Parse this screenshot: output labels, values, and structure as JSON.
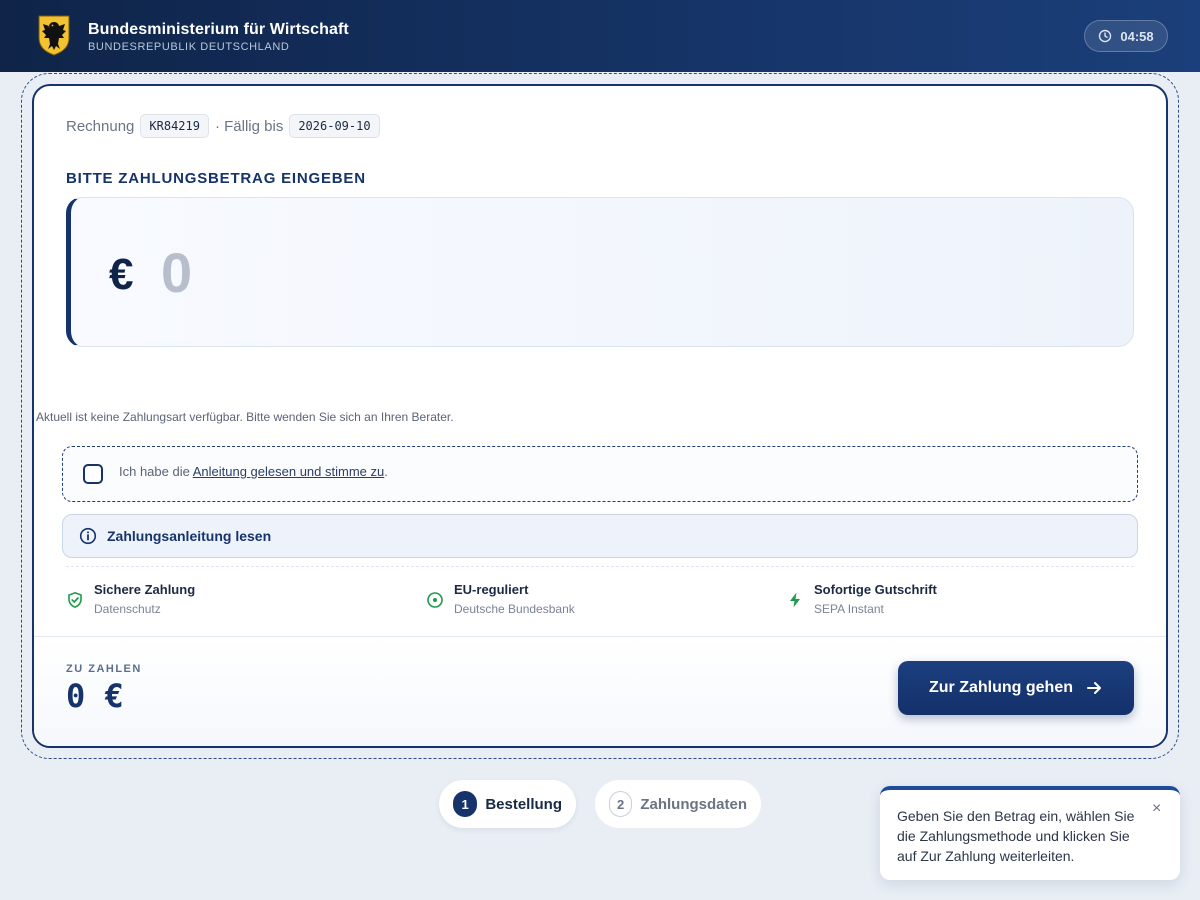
{
  "header": {
    "title": "Bundesministerium für Wirtschaft",
    "subtitle": "BUNDESREPUBLIK DEUTSCHLAND",
    "timer": "04:58"
  },
  "invoice": {
    "label": "Rechnung",
    "number": "KR84219",
    "due_label": "· Fällig bis",
    "due_date": "2026-09-10"
  },
  "amount": {
    "section_title": "BITTE ZAHLUNGSBETRAG EINGEBEN",
    "currency": "€",
    "placeholder": "0",
    "value": ""
  },
  "notice": "Aktuell ist keine Zahlungsart verfügbar. Bitte wenden Sie sich an Ihren Berater.",
  "agreement": {
    "prefix": "Ich habe die ",
    "link": "Anleitung gelesen und stimme zu",
    "suffix": ".",
    "checked": false
  },
  "guide_button": "Zahlungsanleitung lesen",
  "features": [
    {
      "title": "Sichere Zahlung",
      "sub": "Datenschutz",
      "icon": "shield-check-icon"
    },
    {
      "title": "EU-reguliert",
      "sub": "Deutsche Bundesbank",
      "icon": "circle-dot-icon"
    },
    {
      "title": "Sofortige Gutschrift",
      "sub": "SEPA Instant",
      "icon": "lightning-icon"
    }
  ],
  "footer": {
    "due_label": "ZU ZAHLEN",
    "due_value": "0 €",
    "pay_button": "Zur Zahlung gehen"
  },
  "steps": [
    {
      "num": "1",
      "label": "Bestellung",
      "active": true
    },
    {
      "num": "2",
      "label": "Zahlungsdaten",
      "active": false
    }
  ],
  "toast": {
    "text": "Geben Sie den Betrag ein, wählen Sie die Zahlungsmethode und klicken Sie auf Zur Zahlung weiterleiten.",
    "close": "×"
  },
  "colors": {
    "brand_navy": "#16336b",
    "header_dark": "#0f2448",
    "feature_green": "#1f9a4a"
  }
}
